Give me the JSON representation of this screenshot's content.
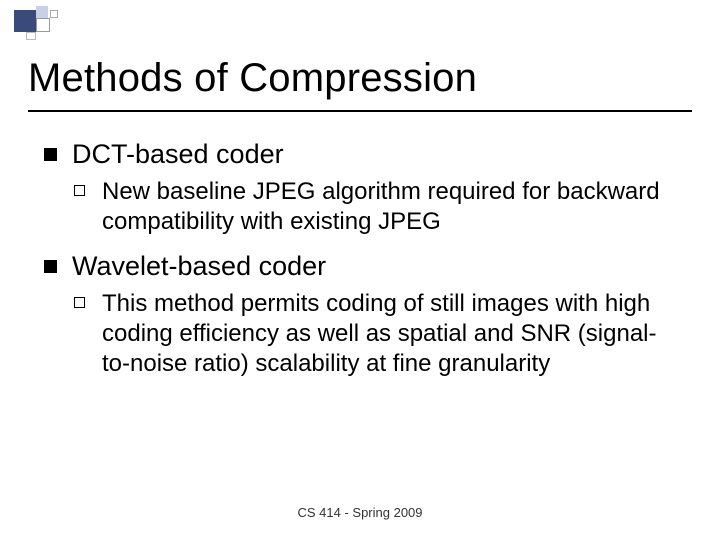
{
  "title": "Methods of Compression",
  "items": [
    {
      "label": "DCT-based coder",
      "sub": "New baseline JPEG algorithm required for backward compatibility with existing JPEG"
    },
    {
      "label": "Wavelet-based coder",
      "sub": "This method permits coding of still images with high coding efficiency as well as spatial and SNR (signal-to-noise ratio) scalability at fine granularity"
    }
  ],
  "footer": "CS 414 - Spring 2009"
}
